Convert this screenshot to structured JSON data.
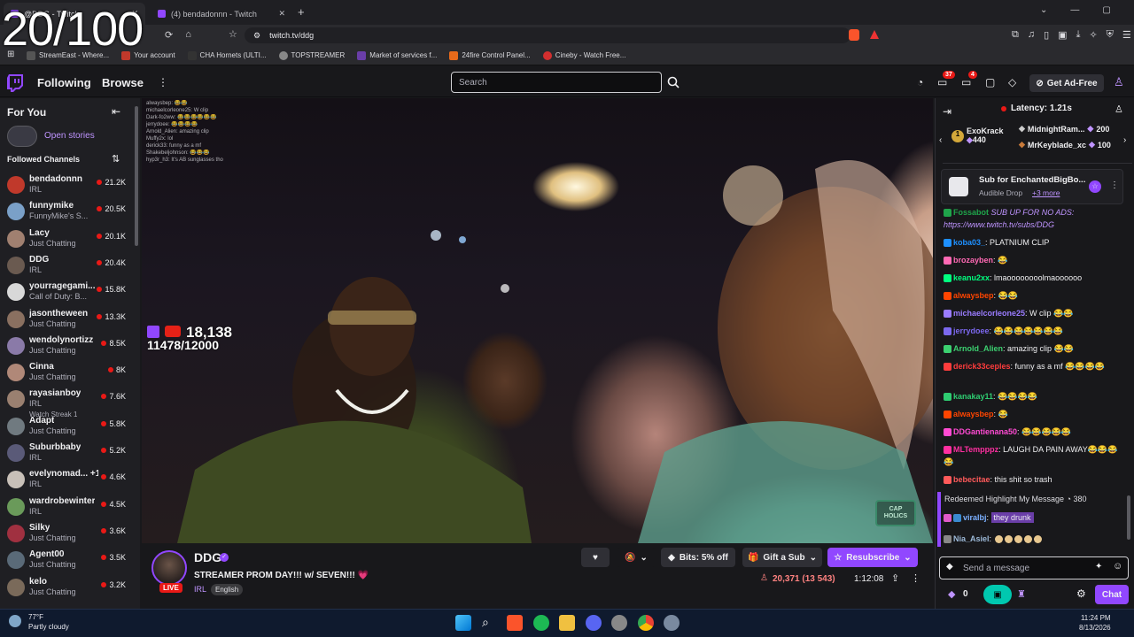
{
  "overlay_counter": "20/100",
  "browser": {
    "tabs": [
      {
        "label": "@DDG - Twitch"
      },
      {
        "label": "(4) bendadonnn - Twitch"
      }
    ],
    "url": "twitch.tv/ddg",
    "bookmarks": [
      "StreamEast - Where...",
      "Your account",
      "CHA Hornets (ULTI...",
      "TOPSTREAMER",
      "Market of services f...",
      "24fire Control Panel...",
      "Cineby - Watch Free..."
    ]
  },
  "twitch": {
    "nav": {
      "following": "Following",
      "browse": "Browse",
      "search_placeholder": "Search",
      "notif_count": "37",
      "inbox_count": "4",
      "ad_free": "Get Ad-Free"
    },
    "sidebar": {
      "for_you": "For You",
      "open_stories": "Open stories",
      "followed_channels": "Followed Channels",
      "channels": [
        {
          "name": "bendadonnn",
          "game": "IRL",
          "viewers": "21.2K",
          "color": "#c0392b"
        },
        {
          "name": "funnymike",
          "game": "FunnyMike's S...",
          "viewers": "20.5K",
          "color": "#7aa0c8"
        },
        {
          "name": "Lacy",
          "game": "Just Chatting",
          "viewers": "20.1K",
          "color": "#a08070"
        },
        {
          "name": "DDG",
          "game": "IRL",
          "viewers": "20.4K",
          "color": "#6a5a50"
        },
        {
          "name": "yourragegami...",
          "game": "Call of Duty: B...",
          "viewers": "15.8K",
          "color": "#d8d8d8"
        },
        {
          "name": "jasontheween",
          "game": "Just Chatting",
          "viewers": "13.3K",
          "color": "#8a7060"
        },
        {
          "name": "wendolynortizz",
          "game": "Just Chatting",
          "viewers": "8.5K",
          "color": "#8a7aa8"
        },
        {
          "name": "Cinna",
          "game": "Just Chatting",
          "viewers": "8K",
          "color": "#b08878"
        },
        {
          "name": "rayasianboy",
          "game": "IRL",
          "viewers": "7.6K",
          "color": "#9a8070",
          "extra": "Watch Streak 1"
        },
        {
          "name": "Adapt",
          "game": "Just Chatting",
          "viewers": "5.8K",
          "color": "#707a80"
        },
        {
          "name": "Suburbbaby",
          "game": "IRL",
          "viewers": "5.2K",
          "color": "#5a5a78"
        },
        {
          "name": "evelynomad... +1",
          "game": "IRL",
          "viewers": "4.6K",
          "color": "#c8c0b8"
        },
        {
          "name": "wardrobewinter",
          "game": "IRL",
          "viewers": "4.5K",
          "color": "#6a9a5a"
        },
        {
          "name": "Silky",
          "game": "Just Chatting",
          "viewers": "3.6K",
          "color": "#a03040"
        },
        {
          "name": "Agent00",
          "game": "Just Chatting",
          "viewers": "3.5K",
          "color": "#5a6a78"
        },
        {
          "name": "kelo",
          "game": "Just Chatting",
          "viewers": "3.2K",
          "color": "#7a6a5a"
        }
      ]
    },
    "video": {
      "overlay_views": "18,138",
      "overlay_goal": "11478/12000",
      "watermark": "CAP HOLICS",
      "overlay_chat": [
        "alwaysbep: 😂😂",
        "michaelcorleone25: W clip",
        "Dark-fo2ww: 😂😂😂😂😂😂",
        "jerrydoee: 😂😂😂😂",
        "Arnold_Alien: amazing clip",
        "Muffy2x: lol",
        "derick33: funny as a mf",
        "Shakebeljohnson: 😂😂😂",
        "hyp3r_h3: It's AB sunglasses tho"
      ]
    },
    "channel": {
      "name": "DDG",
      "live": "LIVE",
      "title": "STREAMER PROM DAY!!! w/ SEVEN!!! 💗",
      "category": "IRL",
      "language": "English",
      "bits_label": "Bits: 5% off",
      "gift_label": "Gift a Sub",
      "subscribe_label": "Resubscribe",
      "viewers": "20,371 (13 543)",
      "uptime": "1:12:08"
    },
    "chat": {
      "latency": "Latency: 1.21s",
      "gifters": [
        {
          "name": "ExoKrack",
          "amount": "440"
        },
        {
          "name": "MidnightRam...",
          "amount": "200"
        },
        {
          "name": "MrKeyblade_xc",
          "amount": "100"
        }
      ],
      "pinned_title": "Sub for EnchantedBigBo...",
      "pinned_sub": "Audible Drop",
      "pinned_more": "+3 more",
      "messages": [
        {
          "user": "Fossabot",
          "color": "#1fa44a",
          "text": "SUB UP FOR NO ADS: https://www.twitch.tv/subs/DDG"
        },
        {
          "user": "koba03_",
          "color": "#1e90ff",
          "text": ": PLATNIUM CLIP"
        },
        {
          "user": "brozayben",
          "color": "#ff69b4",
          "text": ": 😂"
        },
        {
          "user": "keanu2xx",
          "color": "#00ff7f",
          "text": ": lmaoooooooolmaoooooo"
        },
        {
          "user": "alwaysbep",
          "color": "#ff4500",
          "text": ": 😂😂"
        },
        {
          "user": "michaelcorleone25",
          "color": "#9a7cff",
          "text": ": W clip 😂😂"
        },
        {
          "user": "jerrydoee",
          "color": "#7b68ee",
          "text": ": 😂😂😂😂😂😂😂"
        },
        {
          "user": "Arnold_Alien",
          "color": "#3cd070",
          "text": ": amazing clip 😂😂"
        },
        {
          "user": "derick33ceples",
          "color": "#ff3c3c",
          "text": ": funny as a mf 😂😂😂😂"
        },
        {
          "user": "kanakay11",
          "color": "#2ecc71",
          "text": ": 😂😂😂😂"
        },
        {
          "user": "alwaysbep",
          "color": "#ff4500",
          "text": ": 😂"
        },
        {
          "user": "DDGantienana50",
          "color": "#ff4bd3",
          "text": ": 😂😂😂😂😂"
        },
        {
          "user": "MLTempppz",
          "color": "#ff2fa0",
          "text": ": LAUGH DA PAIN AWAY😂😂😂😂"
        },
        {
          "user": "bebecitae",
          "color": "#ff5a5a",
          "text": ": this shit so trash"
        }
      ],
      "redeem_label": "Redeemed Highlight My Message",
      "redeem_cost": "380",
      "highlight": {
        "user": "viralbj",
        "text": "they drunk"
      },
      "last": {
        "user": "Nia_Asiel",
        "text": ":"
      },
      "input_placeholder": "Send a message",
      "points": "0",
      "chat_button": "Chat"
    }
  },
  "taskbar": {
    "temp": "77°F",
    "weather": "Partly cloudy",
    "time": "11:24 PM",
    "date": "8/13/2026"
  }
}
